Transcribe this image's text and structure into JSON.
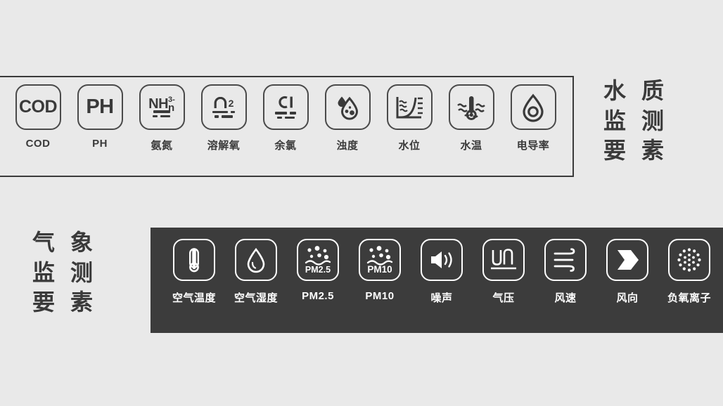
{
  "page": {
    "background_color": "#e9e9e9",
    "dark_panel_color": "#3c3c3c",
    "ink_color": "#3a3a3a",
    "light_ink_color": "#ffffff"
  },
  "water_section": {
    "title_columns": [
      {
        "chars": [
          "水",
          "监",
          "要"
        ]
      },
      {
        "chars": [
          "质",
          "测",
          "素"
        ]
      }
    ],
    "title_full": "水质监测要素",
    "items": [
      {
        "label": "COD",
        "icon": "cod-text-icon",
        "glyph": "COD"
      },
      {
        "label": "PH",
        "icon": "ph-text-icon",
        "glyph": "PH"
      },
      {
        "label": "氨氮",
        "icon": "ammonia-nitrogen-icon",
        "glyph": "NH3-n"
      },
      {
        "label": "溶解氧",
        "icon": "dissolved-oxygen-icon",
        "glyph": "O2"
      },
      {
        "label": "余氯",
        "icon": "residual-chlorine-icon",
        "glyph": "Cl"
      },
      {
        "label": "浊度",
        "icon": "turbidity-droplet-icon",
        "glyph": ""
      },
      {
        "label": "水位",
        "icon": "water-level-gauge-icon",
        "glyph": ""
      },
      {
        "label": "水温",
        "icon": "water-temperature-icon",
        "glyph": ""
      },
      {
        "label": "电导率",
        "icon": "conductivity-droplet-icon",
        "glyph": ""
      }
    ]
  },
  "weather_section": {
    "title_columns": [
      {
        "chars": [
          "气",
          "监",
          "要"
        ]
      },
      {
        "chars": [
          "象",
          "测",
          "素"
        ]
      }
    ],
    "title_full": "气象监测要素",
    "items": [
      {
        "label": "空气温度",
        "icon": "thermometer-icon",
        "glyph": ""
      },
      {
        "label": "空气湿度",
        "icon": "humidity-droplet-icon",
        "glyph": ""
      },
      {
        "label": "PM2.5",
        "icon": "pm25-particles-icon",
        "glyph": "PM2.5"
      },
      {
        "label": "PM10",
        "icon": "pm10-particles-icon",
        "glyph": "PM10"
      },
      {
        "label": "噪声",
        "icon": "speaker-noise-icon",
        "glyph": ""
      },
      {
        "label": "气压",
        "icon": "air-pressure-icon",
        "glyph": ""
      },
      {
        "label": "风速",
        "icon": "wind-speed-icon",
        "glyph": ""
      },
      {
        "label": "风向",
        "icon": "wind-direction-arrow-icon",
        "glyph": ""
      },
      {
        "label": "负氧离子",
        "icon": "negative-oxygen-ion-icon",
        "glyph": ""
      }
    ]
  }
}
